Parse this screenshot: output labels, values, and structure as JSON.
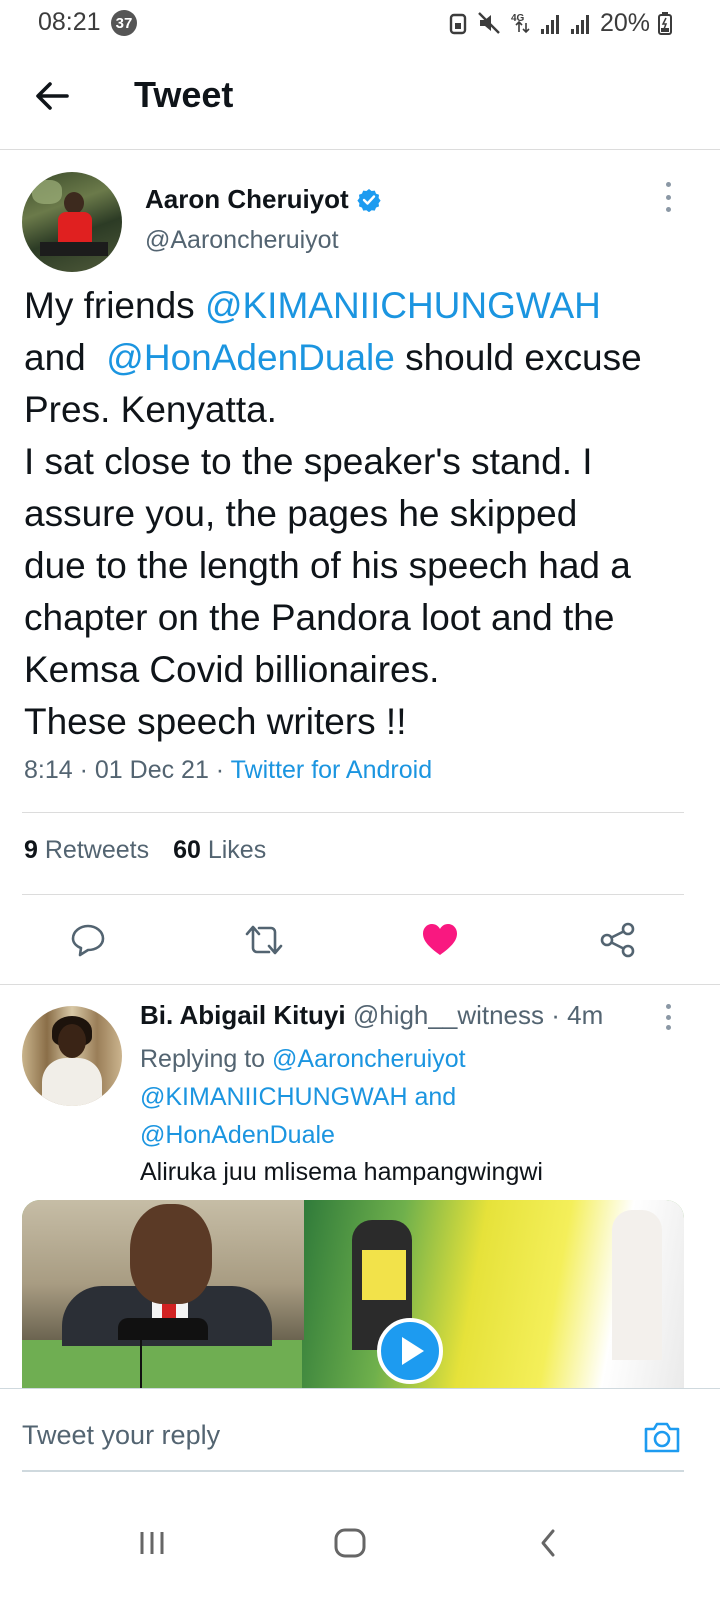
{
  "status_bar": {
    "time": "08:21",
    "notification_count": "37",
    "network": "4G",
    "battery": "20%"
  },
  "header": {
    "title": "Tweet"
  },
  "main_tweet": {
    "author_name": "Aaron Cheruiyot",
    "author_handle": "@Aaroncheruiyot",
    "verified": true,
    "lines": [
      {
        "text_before": "My friends ",
        "mention": "@KIMANIICHUNGWAH",
        "text_after": ""
      },
      {
        "text_before": "and  ",
        "mention": "@HonAdenDuale",
        "text_after": " should excuse"
      },
      {
        "text_before": "Pres. Kenyatta.",
        "mention": "",
        "text_after": ""
      },
      {
        "text_before": "I sat close to the speaker's stand. I",
        "mention": "",
        "text_after": ""
      },
      {
        "text_before": "assure you, the pages he skipped",
        "mention": "",
        "text_after": ""
      },
      {
        "text_before": "due to the length of his speech had a",
        "mention": "",
        "text_after": ""
      },
      {
        "text_before": "chapter on the Pandora loot and the",
        "mention": "",
        "text_after": ""
      },
      {
        "text_before": "Kemsa Covid billionaires.",
        "mention": "",
        "text_after": ""
      },
      {
        "text_before": "These speech writers !!",
        "mention": "",
        "text_after": ""
      }
    ],
    "time": "8:14",
    "date": "01 Dec 21",
    "source": "Twitter for Android",
    "retweets_count": "9",
    "retweets_label": "Retweets",
    "likes_count": "60",
    "likes_label": "Likes",
    "liked": true,
    "accent_color": "#1b95e0",
    "like_color": "#f91880"
  },
  "reply_tweet": {
    "author_name": "Bi. Abigail Kituyi",
    "author_handle": "@high__witness",
    "age": "4m",
    "replying_to_label": "Replying to",
    "replying_mention_1": "@Aaroncheruiyot",
    "replying_mention_2": "@KIMANIICHUNGWAH",
    "replying_and": "and",
    "replying_mention_3": "@HonAdenDuale",
    "text": "Aliruka juu mlisema hampangwingwi",
    "has_video": true
  },
  "composer": {
    "placeholder": "Tweet your reply"
  },
  "icons": {
    "back": "arrow-left-icon",
    "verified": "verified-badge-icon",
    "more": "more-vertical-icon",
    "reply": "reply-bubble-icon",
    "retweet": "retweet-icon",
    "like": "heart-icon",
    "share": "share-icon",
    "camera": "camera-icon",
    "play": "play-icon",
    "nav_recents": "recents-icon",
    "nav_home": "home-icon",
    "nav_back": "nav-back-icon"
  }
}
